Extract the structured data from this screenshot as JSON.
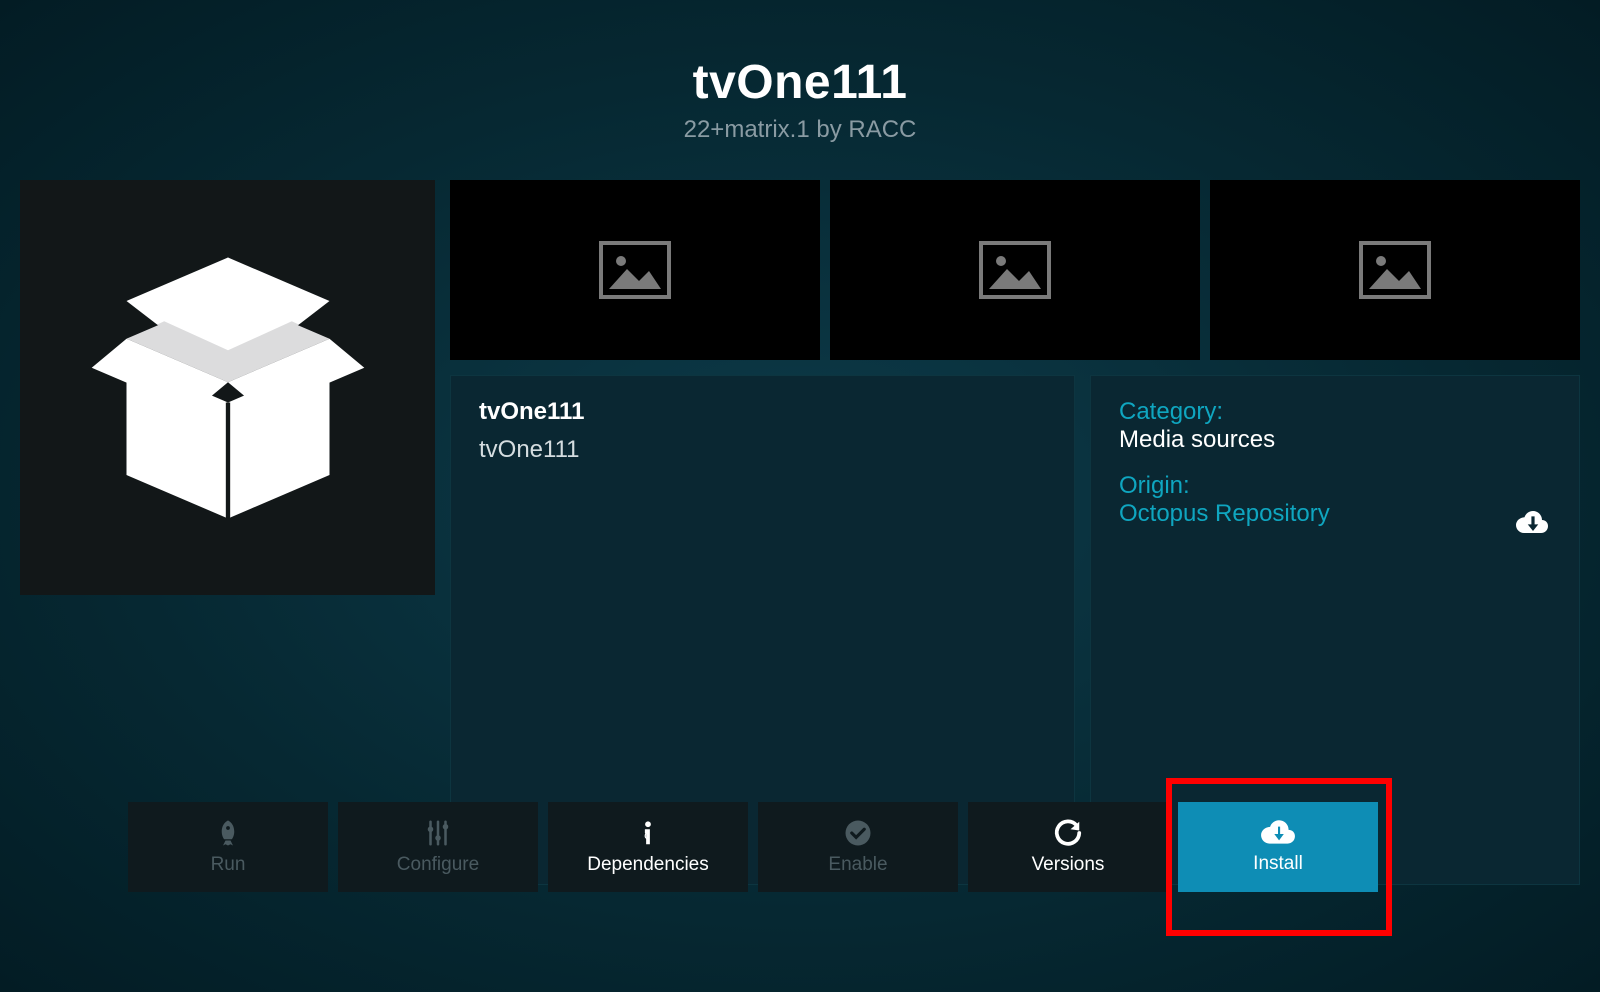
{
  "header": {
    "title": "tvOne111",
    "version": "22+matrix.1",
    "by": "by",
    "author": "RACC"
  },
  "description": {
    "title": "tvOne111",
    "text": "tvOne111"
  },
  "meta": {
    "category_label": "Category:",
    "category_value": "Media sources",
    "origin_label": "Origin:",
    "origin_value": "Octopus Repository"
  },
  "buttons": {
    "run": "Run",
    "configure": "Configure",
    "dependencies": "Dependencies",
    "enable": "Enable",
    "versions": "Versions",
    "install": "Install"
  }
}
